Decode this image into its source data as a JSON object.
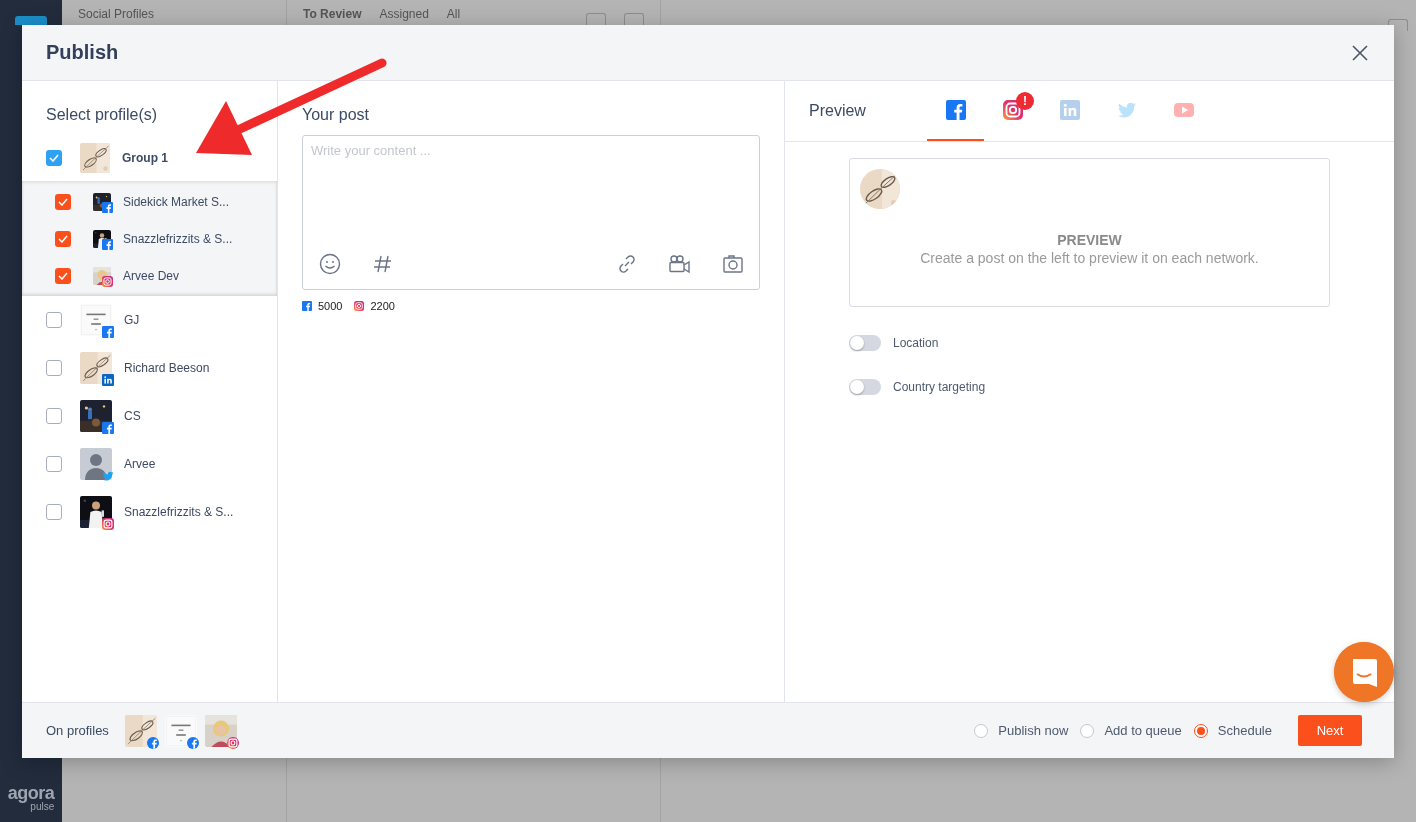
{
  "background": {
    "panel_title": "Social Profiles",
    "tabs": [
      {
        "label": "To Review",
        "selected": true
      },
      {
        "label": "Assigned",
        "selected": false
      },
      {
        "label": "All",
        "selected": false
      }
    ],
    "logo": {
      "word": "agora",
      "sub": "pulse"
    }
  },
  "dialog": {
    "title": "Publish",
    "profiles": {
      "heading": "Select profile(s)",
      "items": [
        {
          "kind": "group",
          "name": "Group 1",
          "checked": true,
          "children": [
            {
              "name": "Sidekick Market S...",
              "checked": true,
              "badge": {
                "kind": "facebook"
              }
            },
            {
              "name": "Snazzlefrizzits & S...",
              "checked": true,
              "badge": {
                "kind": "facebook"
              }
            },
            {
              "name": "Arvee Dev",
              "checked": true,
              "badge": {
                "kind": "instagram"
              }
            }
          ]
        },
        {
          "kind": "profile",
          "name": "GJ",
          "checked": false,
          "badge": {
            "kind": "facebook"
          }
        },
        {
          "kind": "profile",
          "name": "Richard Beeson",
          "checked": false,
          "badge": {
            "kind": "linkedin"
          }
        },
        {
          "kind": "profile",
          "name": "CS",
          "checked": false,
          "badge": {
            "kind": "facebook"
          }
        },
        {
          "kind": "profile",
          "name": "Arvee",
          "checked": false,
          "badge": {
            "kind": "twitter"
          },
          "avatar": {
            "kind": "silhouette"
          }
        },
        {
          "kind": "profile",
          "name": "Snazzlefrizzits & S...",
          "checked": false,
          "badge": {
            "kind": "instagram"
          }
        }
      ]
    },
    "post": {
      "heading": "Your post",
      "placeholder": "Write your content ...",
      "counters": [
        {
          "icon": {
            "kind": "facebook"
          },
          "count": "5000"
        },
        {
          "icon": {
            "kind": "instagram"
          },
          "count": "2200"
        }
      ]
    },
    "preview": {
      "heading": "Preview",
      "networks": [
        {
          "icon": {
            "kind": "facebook"
          },
          "selected": true,
          "disabled": false
        },
        {
          "icon": {
            "kind": "instagram"
          },
          "selected": false,
          "disabled": false,
          "alert": "!"
        },
        {
          "icon": {
            "kind": "linkedin"
          },
          "selected": false,
          "disabled": true
        },
        {
          "icon": {
            "kind": "twitter"
          },
          "selected": false,
          "disabled": true
        },
        {
          "icon": {
            "kind": "youtube"
          },
          "selected": false,
          "disabled": true
        }
      ],
      "card": {
        "title": "PREVIEW",
        "text": "Create a post on the left to preview it on each network."
      },
      "options": [
        {
          "label": "Location",
          "on": false
        },
        {
          "label": "Country targeting",
          "on": false
        }
      ]
    },
    "footer": {
      "label": "On profiles",
      "profiles": [
        {
          "badge": {
            "kind": "facebook"
          }
        },
        {
          "badge": {
            "kind": "facebook"
          }
        },
        {
          "badge": {
            "kind": "instagram"
          }
        }
      ],
      "modes": [
        {
          "label": "Publish now",
          "selected": false
        },
        {
          "label": "Add to queue",
          "selected": false
        },
        {
          "label": "Schedule",
          "selected": true
        }
      ],
      "next_button": "Next"
    }
  }
}
